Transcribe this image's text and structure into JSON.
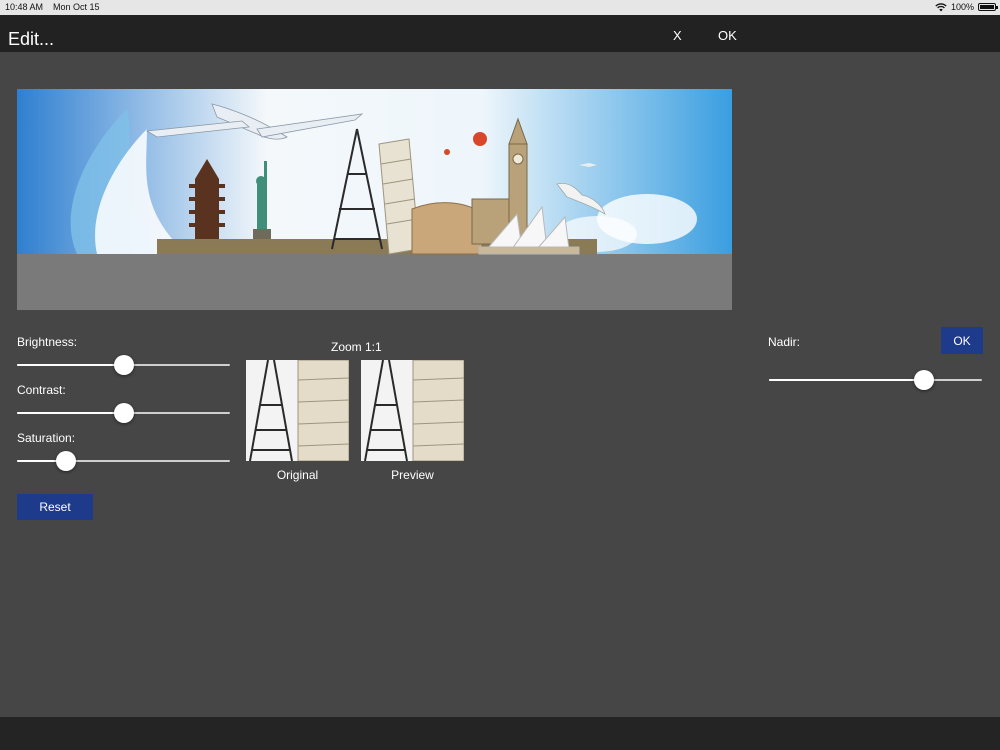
{
  "status": {
    "time": "10:48 AM",
    "date": "Mon Oct 15",
    "battery": "100%"
  },
  "nav": {
    "title": "Edit...",
    "close_label": "X",
    "ok_label": "OK"
  },
  "adjust": {
    "brightness": {
      "label": "Brightness:",
      "value": 0.5
    },
    "contrast": {
      "label": "Contrast:",
      "value": 0.5
    },
    "saturation": {
      "label": "Saturation:",
      "value": 0.23
    },
    "reset_label": "Reset"
  },
  "zoom": {
    "title": "Zoom 1:1",
    "original_label": "Original",
    "preview_label": "Preview"
  },
  "nadir": {
    "label": "Nadir:",
    "ok_label": "OK",
    "value": 0.73
  },
  "colors": {
    "accent": "#1e3a8a",
    "background": "#464646",
    "navbar": "#222222"
  },
  "icons": [
    "wifi-icon",
    "battery-icon"
  ]
}
